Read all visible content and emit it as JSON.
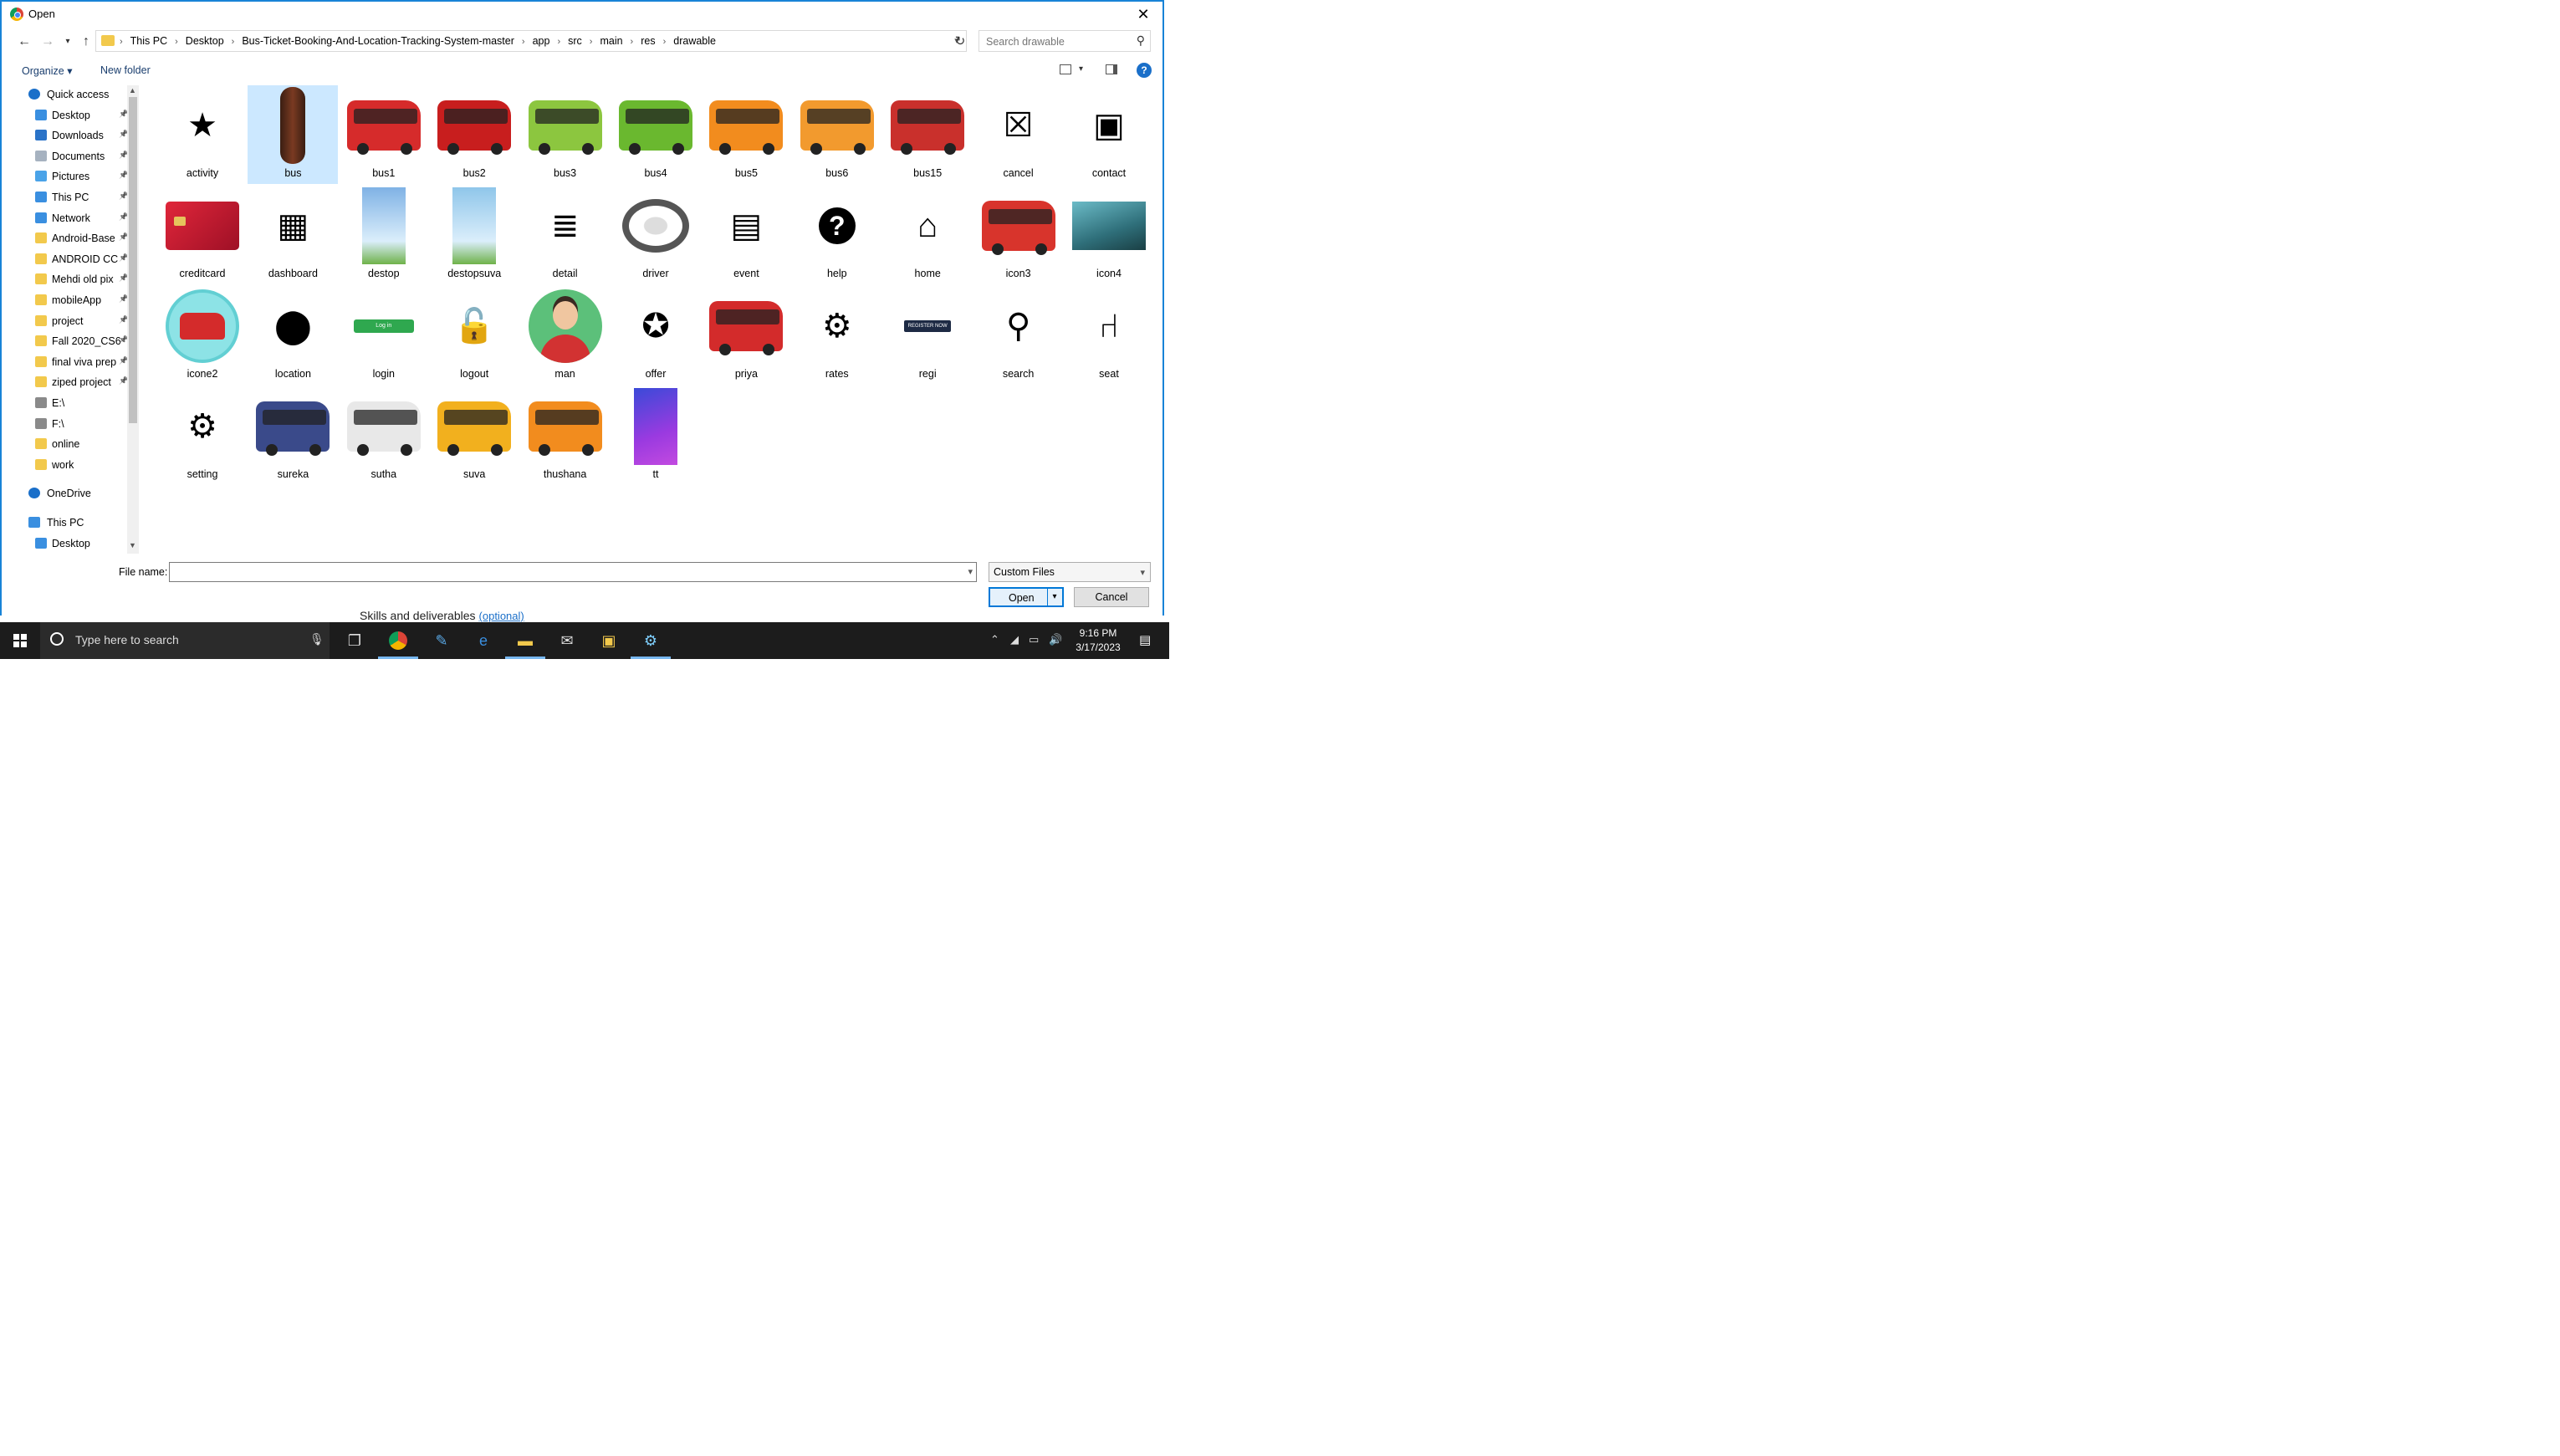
{
  "dialog": {
    "title": "Open",
    "close_glyph": "✕",
    "breadcrumbs": [
      "This PC",
      "Desktop",
      "Bus-Ticket-Booking-And-Location-Tracking-System-master",
      "app",
      "src",
      "main",
      "res",
      "drawable"
    ],
    "search_placeholder": "Search drawable",
    "toolbar": {
      "organize": "Organize ▾",
      "new_folder": "New folder",
      "help": "?"
    }
  },
  "nav_pane": [
    {
      "label": "Quick access",
      "icon": "star-icon",
      "color": "#1a6fc9",
      "indent": 0,
      "pinned": false
    },
    {
      "label": "Desktop",
      "icon": "desktop-icon",
      "color": "#3a8fe0",
      "indent": 1,
      "pinned": true
    },
    {
      "label": "Downloads",
      "icon": "download-icon",
      "color": "#2a73c8",
      "indent": 1,
      "pinned": true
    },
    {
      "label": "Documents",
      "icon": "document-icon",
      "color": "#a6b2c0",
      "indent": 1,
      "pinned": true
    },
    {
      "label": "Pictures",
      "icon": "pictures-icon",
      "color": "#4aa3e8",
      "indent": 1,
      "pinned": true
    },
    {
      "label": "This PC",
      "icon": "pc-icon",
      "color": "#3a8fe0",
      "indent": 1,
      "pinned": true
    },
    {
      "label": "Network",
      "icon": "network-icon",
      "color": "#3a8fe0",
      "indent": 1,
      "pinned": true
    },
    {
      "label": "Android-Base",
      "icon": "folder-icon",
      "color": "#f2c94c",
      "indent": 1,
      "pinned": true
    },
    {
      "label": "ANDROID CC",
      "icon": "folder-icon",
      "color": "#f2c94c",
      "indent": 1,
      "pinned": true
    },
    {
      "label": "Mehdi old pix",
      "icon": "folder-icon",
      "color": "#f2c94c",
      "indent": 1,
      "pinned": true
    },
    {
      "label": "mobileApp",
      "icon": "folder-icon",
      "color": "#f2c94c",
      "indent": 1,
      "pinned": true
    },
    {
      "label": "project",
      "icon": "folder-icon",
      "color": "#f2c94c",
      "indent": 1,
      "pinned": true
    },
    {
      "label": "Fall 2020_CS6",
      "icon": "folder-icon",
      "color": "#f2c94c",
      "indent": 1,
      "pinned": true
    },
    {
      "label": "final viva prep",
      "icon": "folder-icon",
      "color": "#f2c94c",
      "indent": 1,
      "pinned": true
    },
    {
      "label": "ziped project",
      "icon": "folder-icon",
      "color": "#f2c94c",
      "indent": 1,
      "pinned": true
    },
    {
      "label": "E:\\",
      "icon": "drive-icon",
      "color": "#8a8a8a",
      "indent": 1,
      "pinned": false
    },
    {
      "label": "F:\\",
      "icon": "drive-icon",
      "color": "#8a8a8a",
      "indent": 1,
      "pinned": false
    },
    {
      "label": "online",
      "icon": "folder-icon",
      "color": "#f2c94c",
      "indent": 1,
      "pinned": false
    },
    {
      "label": "work",
      "icon": "folder-icon",
      "color": "#f2c94c",
      "indent": 1,
      "pinned": false
    },
    {
      "label": "OneDrive",
      "icon": "cloud-icon",
      "color": "#1a6fc9",
      "indent": 0,
      "pinned": false,
      "gap": true
    },
    {
      "label": "This PC",
      "icon": "pc-icon",
      "color": "#3a8fe0",
      "indent": 0,
      "pinned": false,
      "gap": true
    },
    {
      "label": "Desktop",
      "icon": "desktop-icon",
      "color": "#3a8fe0",
      "indent": 1,
      "pinned": false
    }
  ],
  "files": [
    {
      "name": "activity",
      "kind": "glyph",
      "glyph": "★",
      "icon": "star-badge-icon"
    },
    {
      "name": "bus",
      "kind": "pill",
      "selected": true
    },
    {
      "name": "bus1",
      "kind": "bus",
      "color": "#d62b2b"
    },
    {
      "name": "bus2",
      "kind": "bus",
      "color": "#c81e1e"
    },
    {
      "name": "bus3",
      "kind": "bus",
      "color": "#8cc63f"
    },
    {
      "name": "bus4",
      "kind": "bus",
      "color": "#6ab82f"
    },
    {
      "name": "bus5",
      "kind": "bus",
      "color": "#f28c1e"
    },
    {
      "name": "bus6",
      "kind": "bus",
      "color": "#f29a2e"
    },
    {
      "name": "bus15",
      "kind": "bus",
      "color": "#c9302c"
    },
    {
      "name": "cancel",
      "kind": "glyph",
      "glyph": "☒",
      "icon": "cancel-icon"
    },
    {
      "name": "contact",
      "kind": "glyph",
      "glyph": "▣",
      "icon": "contact-icon"
    },
    {
      "name": "creditcard",
      "kind": "card"
    },
    {
      "name": "dashboard",
      "kind": "glyph",
      "glyph": "▦",
      "icon": "dashboard-icon"
    },
    {
      "name": "destop",
      "kind": "tall",
      "color": "#7fb2e5"
    },
    {
      "name": "destopsuva",
      "kind": "tall",
      "color": "#8fc6ea"
    },
    {
      "name": "detail",
      "kind": "glyph",
      "glyph": "≣",
      "icon": "detail-icon"
    },
    {
      "name": "driver",
      "kind": "wheel"
    },
    {
      "name": "event",
      "kind": "glyph",
      "glyph": "▤",
      "icon": "event-icon"
    },
    {
      "name": "help",
      "kind": "glyph",
      "glyph": "?",
      "icon": "help-icon",
      "circle": true
    },
    {
      "name": "home",
      "kind": "glyph",
      "glyph": "⌂",
      "icon": "home-icon"
    },
    {
      "name": "icon3",
      "kind": "bus",
      "color": "#d8342c"
    },
    {
      "name": "icon4",
      "kind": "photo",
      "color": "#2f6f7a"
    },
    {
      "name": "icone2",
      "kind": "circlebus"
    },
    {
      "name": "location",
      "kind": "glyph",
      "glyph": "⬤",
      "icon": "location-pin-icon"
    },
    {
      "name": "login",
      "kind": "loginbtn",
      "label": "Log in"
    },
    {
      "name": "logout",
      "kind": "glyph",
      "glyph": "🔓",
      "icon": "logout-icon"
    },
    {
      "name": "man",
      "kind": "avatar"
    },
    {
      "name": "offer",
      "kind": "glyph",
      "glyph": "✪",
      "icon": "offer-icon"
    },
    {
      "name": "priya",
      "kind": "bus",
      "color": "#d32b2b"
    },
    {
      "name": "rates",
      "kind": "glyph",
      "glyph": "⚙",
      "icon": "rates-icon"
    },
    {
      "name": "regi",
      "kind": "regibtn",
      "label": "REGISTER NOW"
    },
    {
      "name": "search",
      "kind": "glyph",
      "glyph": "⚲",
      "icon": "search-icon"
    },
    {
      "name": "seat",
      "kind": "glyph",
      "glyph": "⑁",
      "icon": "seat-icon"
    },
    {
      "name": "setting",
      "kind": "glyph",
      "glyph": "⚙",
      "icon": "gear-icon"
    },
    {
      "name": "sureka",
      "kind": "bus",
      "color": "#3a4a8a"
    },
    {
      "name": "sutha",
      "kind": "bus",
      "color": "#e8e8e8"
    },
    {
      "name": "suva",
      "kind": "bus",
      "color": "#f2b01e"
    },
    {
      "name": "thushana",
      "kind": "bus",
      "color": "#f28c1e"
    },
    {
      "name": "tt",
      "kind": "gradient"
    }
  ],
  "bottom": {
    "file_name_label": "File name:",
    "file_name_value": "",
    "filter": "Custom Files",
    "open": "Open",
    "cancel": "Cancel"
  },
  "background": {
    "text": "Skills and deliverables",
    "optional": "(optional)"
  },
  "taskbar": {
    "search_placeholder": "Type here to search",
    "time": "9:16 PM",
    "date": "3/17/2023"
  }
}
